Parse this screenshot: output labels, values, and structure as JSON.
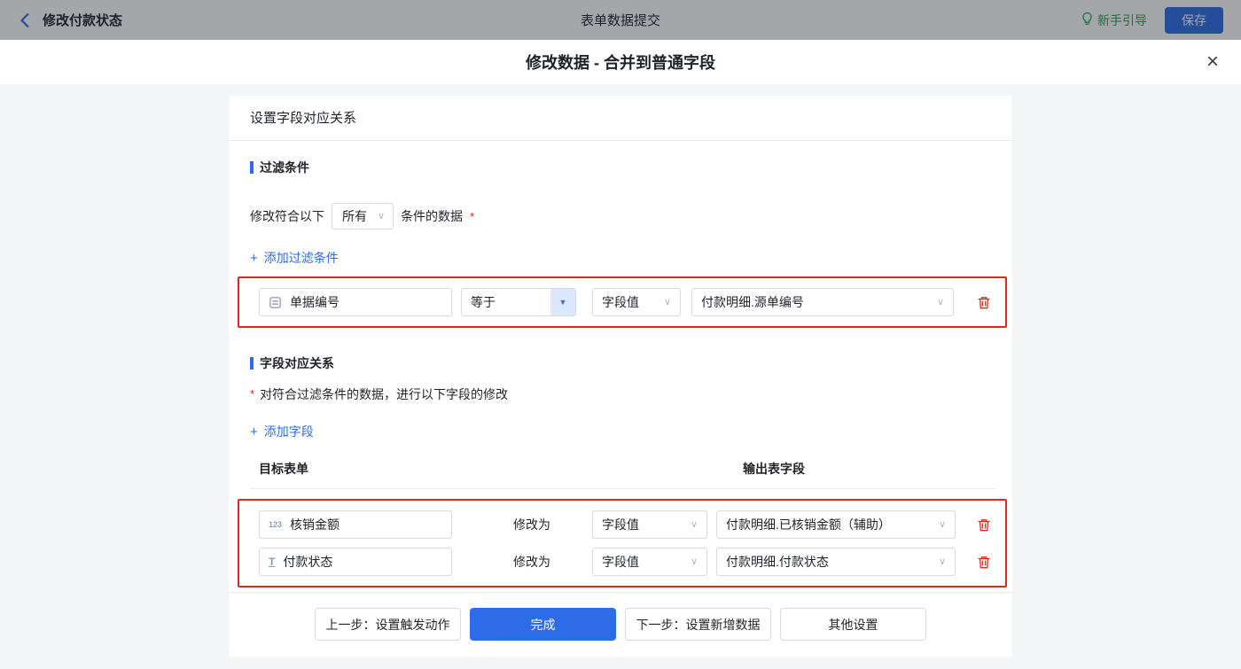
{
  "icons": {
    "caret": "∨",
    "dropdown_caret": "▼",
    "close": "×",
    "plus": "+"
  },
  "topbar": {
    "back_label": "修改付款状态",
    "title": "表单数据提交",
    "guide_label": "新手引导",
    "save_label": "保存"
  },
  "dialog": {
    "title": "修改数据 - 合并到普通字段"
  },
  "panel": {
    "header": "设置字段对应关系",
    "filter": {
      "section_title": "过滤条件",
      "prefix": "修改符合以下",
      "match_option": "所有",
      "suffix": "条件的数据",
      "required": "*",
      "add_label": "添加过滤条件",
      "row": {
        "field": "单据编号",
        "operator": "等于",
        "value_type": "字段值",
        "value_field": "付款明细.源单编号"
      }
    },
    "mapping": {
      "section_title": "字段对应关系",
      "required": "*",
      "description": "对符合过滤条件的数据，进行以下字段的修改",
      "add_label": "添加字段",
      "columns": {
        "target": "目标表单",
        "output": "输出表字段"
      },
      "rows": [
        {
          "field_icon": "123",
          "field": "核销金额",
          "action": "修改为",
          "value_type": "字段值",
          "value_field": "付款明细.已核销金额（辅助）"
        },
        {
          "field_icon": "T",
          "field": "付款状态",
          "action": "修改为",
          "value_type": "字段值",
          "value_field": "付款明细.付款状态"
        }
      ]
    },
    "footer": {
      "prev": "上一步：设置触发动作",
      "done": "完成",
      "next": "下一步：设置新增数据",
      "other": "其他设置"
    }
  },
  "colors": {
    "accent": "#2e6be6",
    "danger": "#e5261f",
    "guide_green": "#21a454"
  }
}
